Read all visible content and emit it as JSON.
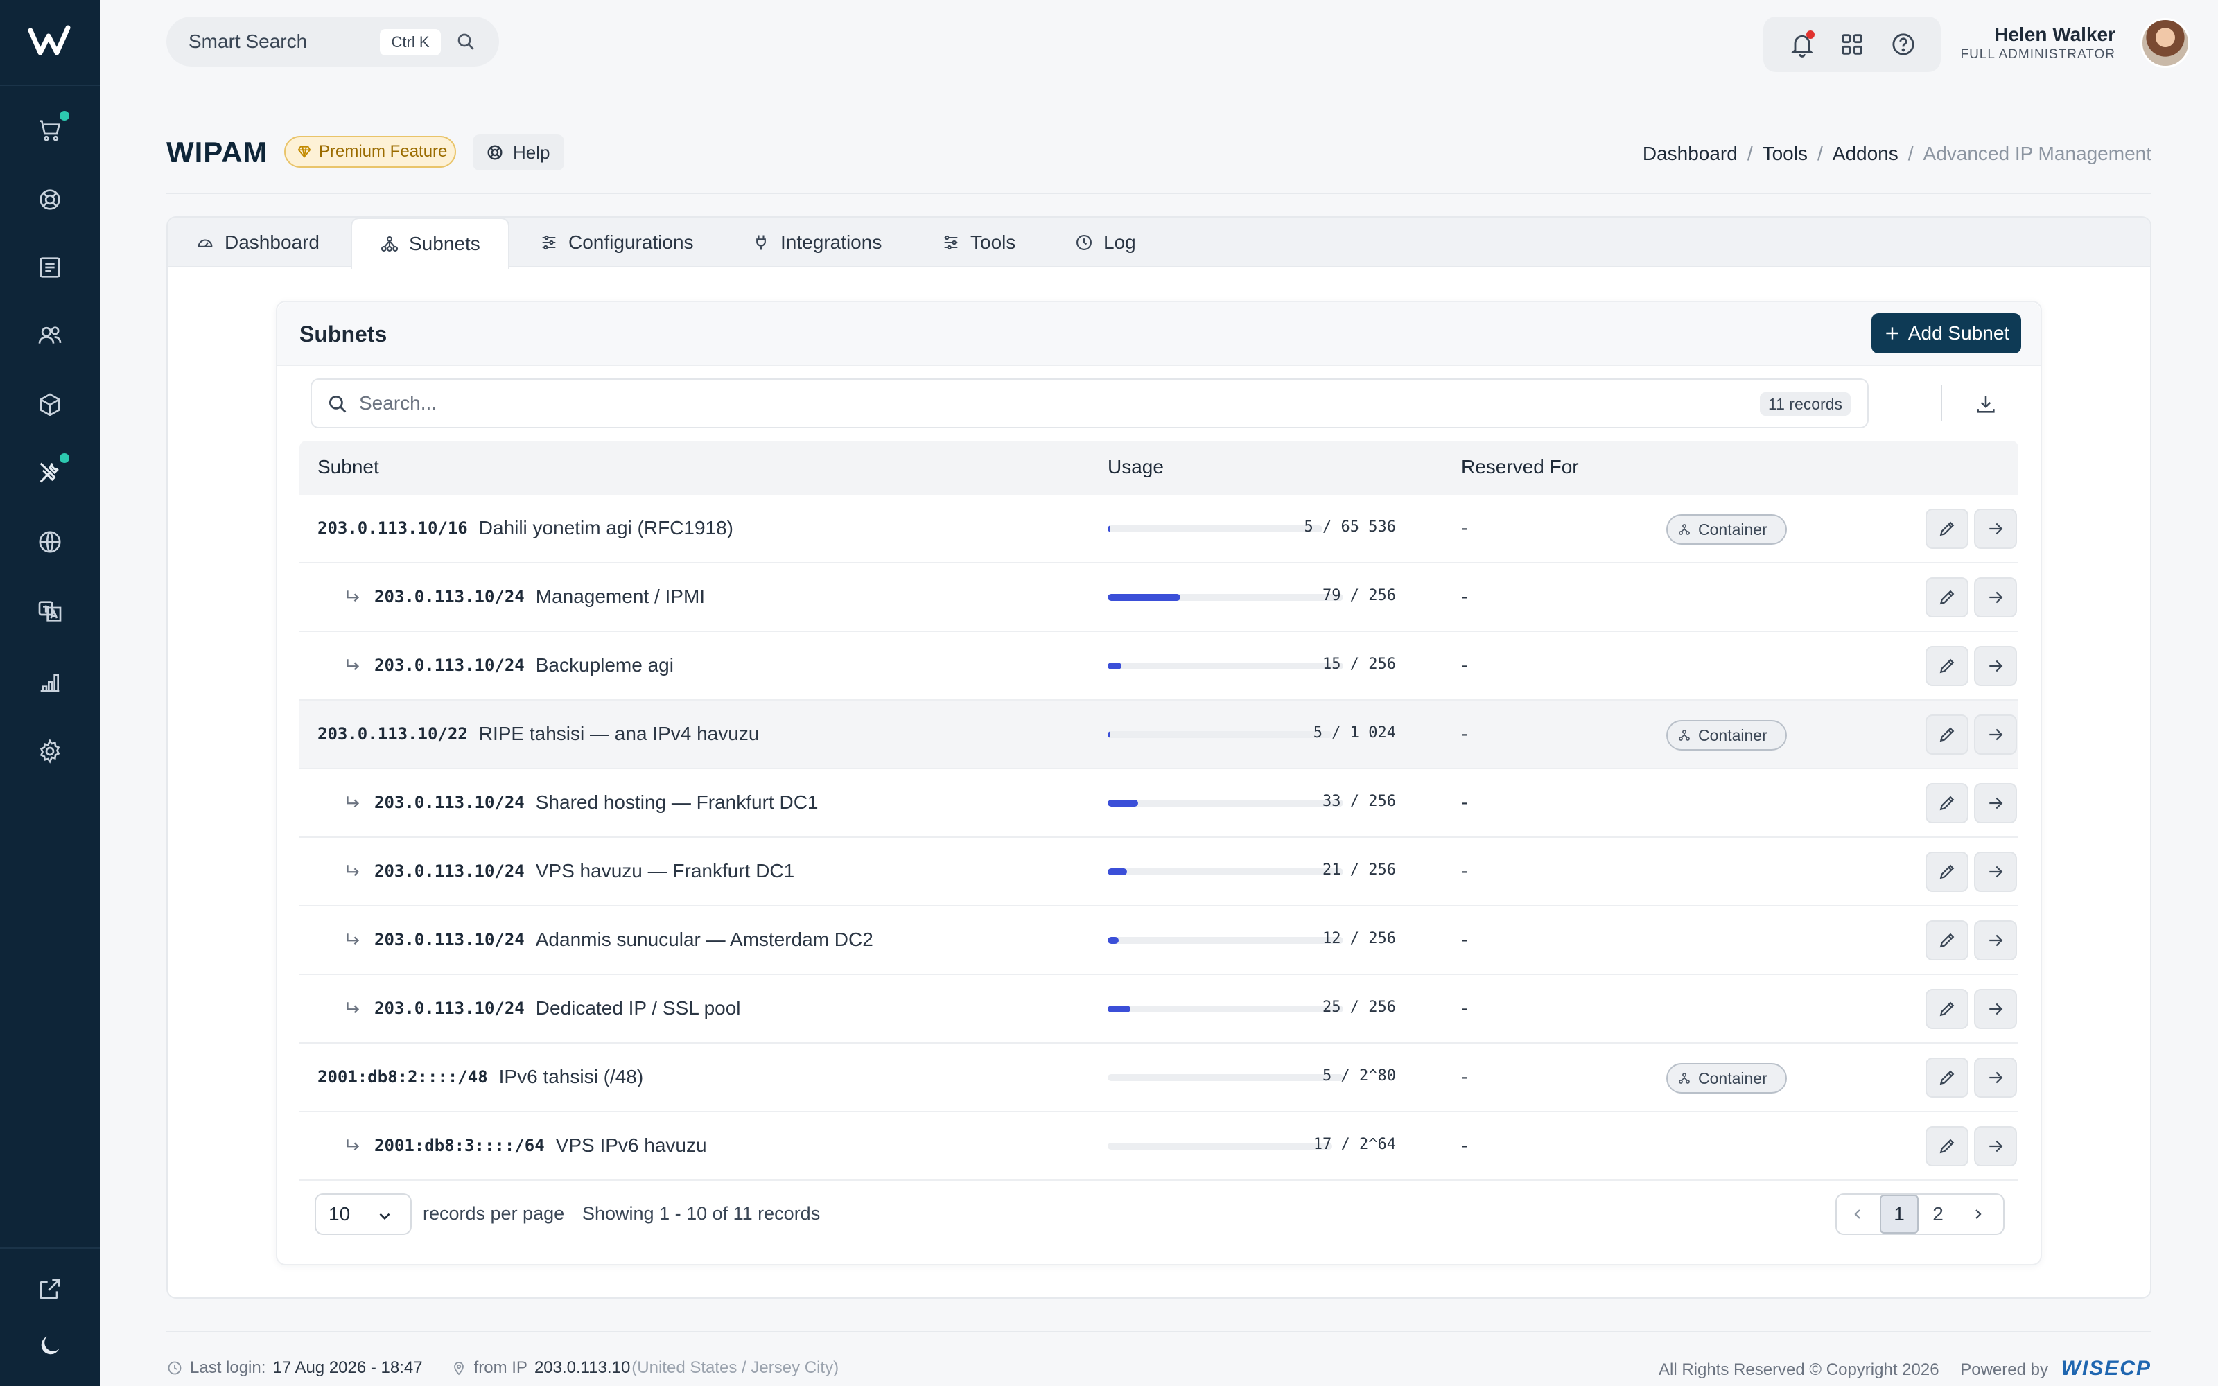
{
  "sidebar": {
    "items": [
      {
        "icon": "cart-icon",
        "dot": true
      },
      {
        "icon": "lifebuoy-icon",
        "dot": false
      },
      {
        "icon": "invoice-icon",
        "dot": false
      },
      {
        "icon": "users-icon",
        "dot": false
      },
      {
        "icon": "box-icon",
        "dot": false
      },
      {
        "icon": "tools-icon",
        "dot": true
      },
      {
        "icon": "globe-icon",
        "dot": false
      },
      {
        "icon": "translate-icon",
        "dot": false
      },
      {
        "icon": "chart-icon",
        "dot": false
      },
      {
        "icon": "gear-icon",
        "dot": false
      }
    ],
    "bottom": [
      {
        "icon": "external-link-icon"
      },
      {
        "icon": "moon-icon"
      }
    ]
  },
  "topbar": {
    "search_label": "Smart Search",
    "shortcut": "Ctrl K",
    "user_name": "Helen Walker",
    "user_role": "FULL ADMINISTRATOR"
  },
  "header": {
    "title": "WIPAM",
    "premium_label": "Premium Feature",
    "help_label": "Help",
    "breadcrumbs": [
      "Dashboard",
      "Tools",
      "Addons"
    ],
    "breadcrumb_current": "Advanced IP Management"
  },
  "tabs": [
    {
      "label": "Dashboard",
      "icon": "gauge-icon"
    },
    {
      "label": "Subnets",
      "icon": "sitemap-icon",
      "active": true
    },
    {
      "label": "Configurations",
      "icon": "sliders-icon"
    },
    {
      "label": "Integrations",
      "icon": "plug-icon"
    },
    {
      "label": "Tools",
      "icon": "adjustments-icon"
    },
    {
      "label": "Log",
      "icon": "clock-icon"
    }
  ],
  "panel": {
    "title": "Subnets",
    "add_label": "Add Subnet",
    "search_placeholder": "Search...",
    "records_badge": "11 records"
  },
  "table": {
    "columns": [
      "Subnet",
      "Usage",
      "Reserved For"
    ],
    "rows": [
      {
        "ip": "203.0.113.10/16",
        "desc": "Dahili yonetim agi (RFC1918)",
        "child": false,
        "usage_fraction": 0.0001,
        "count": "5 / 65 536",
        "reserved": "-",
        "badge": "Container"
      },
      {
        "ip": "203.0.113.10/24",
        "desc": "Management / IPMI",
        "child": true,
        "usage_fraction": 0.309,
        "count": "79 / 256",
        "reserved": "-",
        "badge": ""
      },
      {
        "ip": "203.0.113.10/24",
        "desc": "Backupleme agi",
        "child": true,
        "usage_fraction": 0.059,
        "count": "15 / 256",
        "reserved": "-",
        "badge": ""
      },
      {
        "ip": "203.0.113.10/22",
        "desc": "RIPE tahsisi — ana IPv4 havuzu",
        "child": false,
        "usage_fraction": 0.005,
        "count": "5 / 1 024",
        "reserved": "-",
        "badge": "Container",
        "highlight": true
      },
      {
        "ip": "203.0.113.10/24",
        "desc": "Shared hosting — Frankfurt DC1",
        "child": true,
        "usage_fraction": 0.129,
        "count": "33 / 256",
        "reserved": "-",
        "badge": ""
      },
      {
        "ip": "203.0.113.10/24",
        "desc": "VPS havuzu — Frankfurt DC1",
        "child": true,
        "usage_fraction": 0.082,
        "count": "21 / 256",
        "reserved": "-",
        "badge": ""
      },
      {
        "ip": "203.0.113.10/24",
        "desc": "Adanmis sunucular — Amsterdam DC2",
        "child": true,
        "usage_fraction": 0.047,
        "count": "12 / 256",
        "reserved": "-",
        "badge": ""
      },
      {
        "ip": "203.0.113.10/24",
        "desc": "Dedicated IP / SSL pool",
        "child": true,
        "usage_fraction": 0.098,
        "count": "25 / 256",
        "reserved": "-",
        "badge": ""
      },
      {
        "ip": "2001:db8:2::::/48",
        "desc": "IPv6 tahsisi (/48)",
        "child": false,
        "usage_fraction": 0,
        "count": "5 / 2^80",
        "reserved": "-",
        "badge": "Container"
      },
      {
        "ip": "2001:db8:3::::/64",
        "desc": "VPS IPv6 havuzu",
        "child": true,
        "usage_fraction": 0,
        "count": "17 / 2^64",
        "reserved": "-",
        "badge": ""
      }
    ]
  },
  "pagination": {
    "per_page": "10",
    "per_page_label": "records per page",
    "showing": "Showing 1 - 10 of 11 records",
    "pages": [
      "1",
      "2"
    ],
    "current": "1"
  },
  "footer": {
    "last_login_label": "Last login:",
    "last_login_value": "17 Aug 2026 - 18:47",
    "from_ip_label": "from IP",
    "ip": "203.0.113.10",
    "location": "(United States / Jersey City)",
    "rights": "All Rights Reserved © Copyright 2026",
    "powered_by": "Powered by",
    "brand": "WISECP"
  },
  "colors": {
    "sidebar_bg": "#0e2538",
    "accent_dot": "#2dc9b0",
    "usage_fill": "#3b4fd8",
    "primary_button": "#0e3a55",
    "notification_dot": "#e0322f"
  }
}
